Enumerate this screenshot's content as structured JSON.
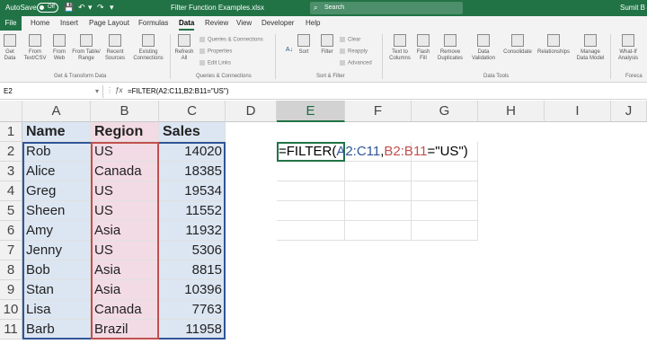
{
  "titlebar": {
    "autosave_label": "AutoSave",
    "autosave_state": "Off",
    "filename": "Filter Function Examples.xlsx",
    "search_placeholder": "Search",
    "user": "Sumit B"
  },
  "menu": {
    "file": "File",
    "tabs": [
      "Home",
      "Insert",
      "Page Layout",
      "Formulas",
      "Data",
      "Review",
      "View",
      "Developer",
      "Help"
    ],
    "active": "Data"
  },
  "ribbon": {
    "get_data": [
      "Get",
      "Data"
    ],
    "from_text": [
      "From",
      "Text/CSV"
    ],
    "from_web": [
      "From",
      "Web"
    ],
    "from_table": [
      "From Table/",
      "Range"
    ],
    "recent_sources": [
      "Recent",
      "Sources"
    ],
    "existing_connections": [
      "Existing",
      "Connections"
    ],
    "group_get_transform": "Get & Transform Data",
    "refresh_all": [
      "Refresh",
      "All"
    ],
    "queries_connections": "Queries & Connections",
    "properties": "Properties",
    "edit_links": "Edit Links",
    "group_queries": "Queries & Connections",
    "sort": "Sort",
    "filter": "Filter",
    "clear": "Clear",
    "reapply": "Reapply",
    "advanced": "Advanced",
    "group_sort_filter": "Sort & Filter",
    "text_to_columns": [
      "Text to",
      "Columns"
    ],
    "flash_fill": [
      "Flash",
      "Fill"
    ],
    "remove_duplicates": [
      "Remove",
      "Duplicates"
    ],
    "data_validation": [
      "Data",
      "Validation"
    ],
    "consolidate": "Consolidate",
    "relationships": "Relationships",
    "manage_data_model": [
      "Manage",
      "Data Model"
    ],
    "group_data_tools": "Data Tools",
    "what_if": [
      "What-If",
      "Analysis"
    ],
    "group_forecast": "Foreca"
  },
  "formula_bar": {
    "name_box": "E2",
    "formula": "=FILTER(A2:C11,B2:B11=\"US\")"
  },
  "columns": [
    "A",
    "B",
    "C",
    "D",
    "E",
    "F",
    "G",
    "H",
    "I",
    "J"
  ],
  "rows": [
    "1",
    "2",
    "3",
    "4",
    "5",
    "6",
    "7",
    "8",
    "9",
    "10",
    "11"
  ],
  "table": {
    "headers": [
      "Name",
      "Region",
      "Sales"
    ],
    "data": [
      [
        "Rob",
        "US",
        "14020"
      ],
      [
        "Alice",
        "Canada",
        "18385"
      ],
      [
        "Greg",
        "US",
        "19534"
      ],
      [
        "Sheen",
        "US",
        "11552"
      ],
      [
        "Amy",
        "Asia",
        "11932"
      ],
      [
        "Jenny",
        "US",
        "5306"
      ],
      [
        "Bob",
        "Asia",
        "8815"
      ],
      [
        "Stan",
        "Asia",
        "10396"
      ],
      [
        "Lisa",
        "Canada",
        "7763"
      ],
      [
        "Barb",
        "Brazil",
        "11958"
      ]
    ]
  },
  "edit_cell": {
    "prefix": "=FILTER(",
    "ref1": "A2:C11",
    "comma": ",",
    "ref2": "B2:B11",
    "suffix": "=\"US\")"
  },
  "colors": {
    "brand": "#217346",
    "ref_blue": "#2f5597",
    "ref_red": "#c0504d",
    "range_blue_fill": "#dce6f2",
    "range_pink_fill": "#f2dbe4"
  }
}
